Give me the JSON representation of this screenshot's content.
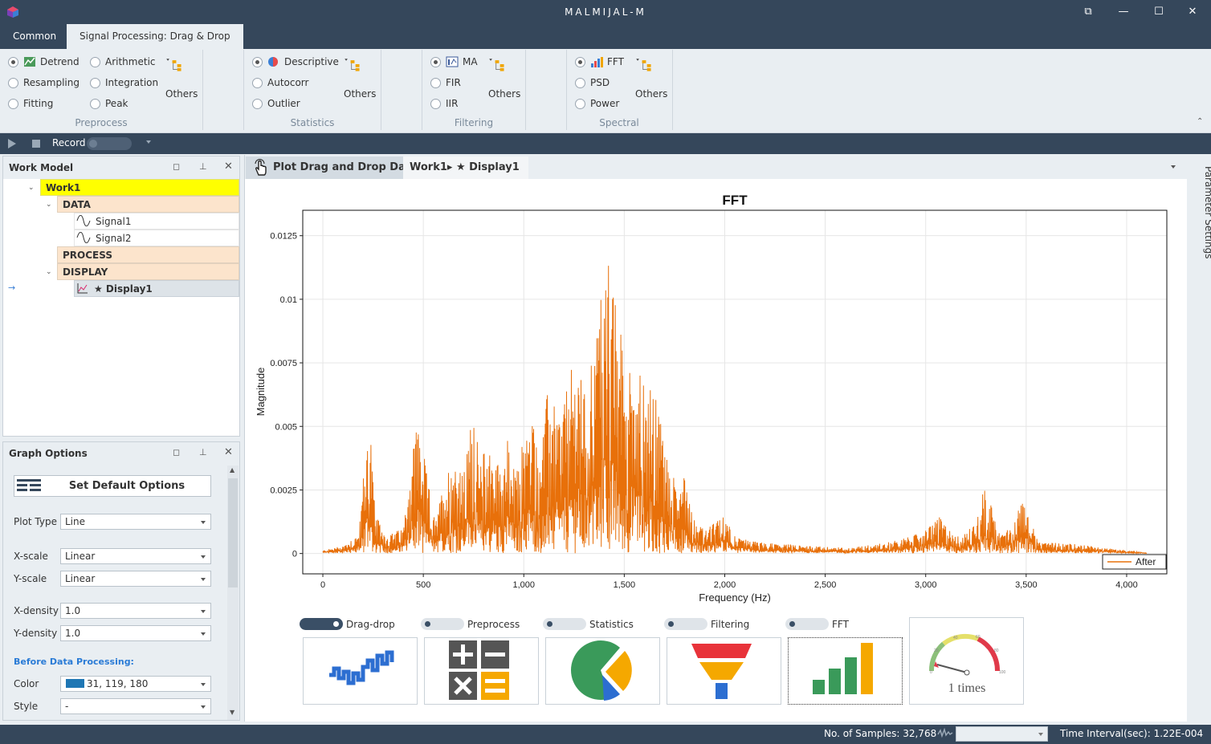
{
  "window": {
    "title": "MALMIJAL-M",
    "controls": [
      "⧉",
      "—",
      "☐",
      "✕"
    ]
  },
  "ribbon_tabs": [
    {
      "label": "Common"
    },
    {
      "label": "Signal Processing: Drag & Drop"
    }
  ],
  "ribbon": {
    "groups": [
      {
        "label": "Preprocess",
        "items": [
          "Detrend",
          "Resampling",
          "Fitting",
          "Arithmetic",
          "Integration",
          "Peak"
        ],
        "others": "Others"
      },
      {
        "label": "Statistics",
        "items": [
          "Descriptive",
          "Autocorr",
          "Outlier"
        ],
        "others": "Others"
      },
      {
        "label": "Filtering",
        "items": [
          "MA",
          "FIR",
          "IIR"
        ],
        "others": "Others"
      },
      {
        "label": "Spectral",
        "items": [
          "FFT",
          "PSD",
          "Power"
        ],
        "others": "Others"
      }
    ]
  },
  "toolbar": {
    "record_label": "Record"
  },
  "work_model": {
    "title": "Work Model",
    "tree": {
      "root": "Work1",
      "data": "DATA",
      "signals": [
        "Signal1",
        "Signal2"
      ],
      "process": "PROCESS",
      "display": "DISPLAY",
      "display_item": "★ Display1"
    }
  },
  "graph_options": {
    "title": "Graph Options",
    "default_button": "Set Default Options",
    "plot_type_label": "Plot Type",
    "plot_type": "Line",
    "xscale_label": "X-scale",
    "xscale": "Linear",
    "yscale_label": "Y-scale",
    "yscale": "Linear",
    "xdensity_label": "X-density",
    "xdensity": "1.0",
    "ydensity_label": "Y-density",
    "ydensity": "1.0",
    "section": "Before Data Processing:",
    "color_label": "Color",
    "color_value": "31, 119, 180",
    "color_swatch": "#1f77b4",
    "style_label": "Style",
    "style_value": "-"
  },
  "doc_tabs": {
    "drag_tab": "Plot Drag and Drop Data",
    "display_tab": "Work1▸ ★ Display1"
  },
  "side_panel": {
    "label": "Parameter Settings"
  },
  "chart_data": {
    "type": "line",
    "title": "FFT",
    "xlabel": "Frequency (Hz)",
    "ylabel": "Magnitude",
    "xlim": [
      -100,
      4200
    ],
    "ylim": [
      -0.0008,
      0.0135
    ],
    "xticks": [
      "0",
      "500",
      "1,000",
      "1,500",
      "2,000",
      "2,500",
      "3,000",
      "3,500",
      "4,000"
    ],
    "xtick_values": [
      0,
      500,
      1000,
      1500,
      2000,
      2500,
      3000,
      3500,
      4000
    ],
    "yticks": [
      "0",
      "0.0025",
      "0.005",
      "0.0075",
      "0.01",
      "0.0125"
    ],
    "ytick_values": [
      0,
      0.0025,
      0.005,
      0.0075,
      0.01,
      0.0125
    ],
    "grid": true,
    "legend": "bottom-right",
    "series": [
      {
        "name": "After",
        "color": "#e8700a",
        "envelope": [
          [
            0,
            0.0001
          ],
          [
            100,
            0.0003
          ],
          [
            180,
            0.0008
          ],
          [
            210,
            0.004
          ],
          [
            235,
            0.0055
          ],
          [
            260,
            0.0015
          ],
          [
            320,
            0.0007
          ],
          [
            400,
            0.001
          ],
          [
            450,
            0.0045
          ],
          [
            475,
            0.0055
          ],
          [
            500,
            0.004
          ],
          [
            540,
            0.002
          ],
          [
            560,
            0.0012
          ],
          [
            600,
            0.0028
          ],
          [
            650,
            0.004
          ],
          [
            700,
            0.003
          ],
          [
            750,
            0.006
          ],
          [
            780,
            0.0035
          ],
          [
            820,
            0.0045
          ],
          [
            870,
            0.0036
          ],
          [
            920,
            0.0045
          ],
          [
            960,
            0.003
          ],
          [
            1000,
            0.0048
          ],
          [
            1040,
            0.0055
          ],
          [
            1080,
            0.004
          ],
          [
            1120,
            0.0065
          ],
          [
            1180,
            0.0055
          ],
          [
            1220,
            0.0068
          ],
          [
            1260,
            0.0078
          ],
          [
            1300,
            0.0065
          ],
          [
            1340,
            0.008
          ],
          [
            1380,
            0.01
          ],
          [
            1410,
            0.0128
          ],
          [
            1440,
            0.0105
          ],
          [
            1480,
            0.009
          ],
          [
            1520,
            0.0072
          ],
          [
            1560,
            0.0082
          ],
          [
            1600,
            0.0065
          ],
          [
            1640,
            0.0065
          ],
          [
            1680,
            0.0055
          ],
          [
            1720,
            0.0035
          ],
          [
            1760,
            0.0028
          ],
          [
            1800,
            0.0035
          ],
          [
            1840,
            0.0015
          ],
          [
            1900,
            0.0009
          ],
          [
            2000,
            0.0015
          ],
          [
            2060,
            0.0006
          ],
          [
            2200,
            0.0004
          ],
          [
            2400,
            0.0003
          ],
          [
            2600,
            0.0002
          ],
          [
            2800,
            0.0004
          ],
          [
            2900,
            0.0006
          ],
          [
            3000,
            0.0009
          ],
          [
            3060,
            0.0015
          ],
          [
            3120,
            0.0009
          ],
          [
            3180,
            0.0006
          ],
          [
            3240,
            0.0012
          ],
          [
            3300,
            0.0028
          ],
          [
            3360,
            0.0008
          ],
          [
            3420,
            0.001
          ],
          [
            3480,
            0.0022
          ],
          [
            3520,
            0.0015
          ],
          [
            3560,
            0.0004
          ],
          [
            3700,
            0.0004
          ],
          [
            3900,
            0.0002
          ],
          [
            4100,
            0
          ]
        ]
      }
    ]
  },
  "toggles": [
    {
      "label": "Drag-drop",
      "on": true
    },
    {
      "label": "Preprocess",
      "on": false
    },
    {
      "label": "Statistics",
      "on": false
    },
    {
      "label": "Filtering",
      "on": false
    },
    {
      "label": "FFT",
      "on": false
    }
  ],
  "gauge": {
    "label": "1 times",
    "ticks": [
      "0",
      "20",
      "40",
      "60",
      "80",
      "100"
    ]
  },
  "status": {
    "samples": "No. of Samples: 32,768",
    "interval": "Time Interval(sec): 1.22E-004"
  }
}
